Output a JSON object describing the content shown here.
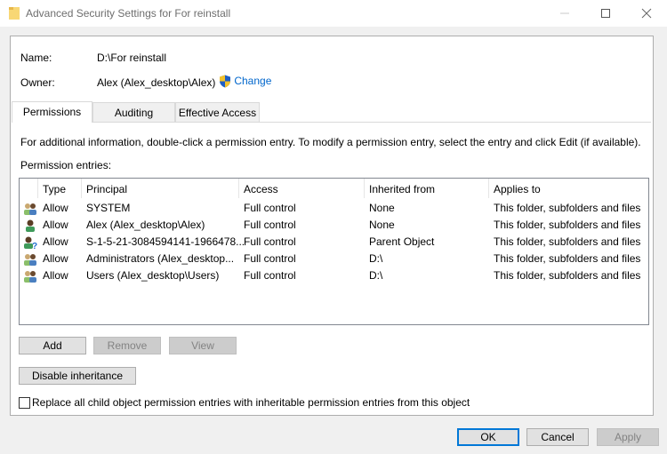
{
  "window": {
    "title": "Advanced Security Settings for For reinstall",
    "icon": "folder-icon",
    "controls": [
      "minimize-icon",
      "maximize-icon",
      "close-icon"
    ]
  },
  "info": {
    "name_label": "Name:",
    "name_value": "D:\\For reinstall",
    "owner_label": "Owner:",
    "owner_value": "Alex (Alex_desktop\\Alex)",
    "change_label": "Change",
    "change_icon": "uac-shield-icon"
  },
  "tabs": [
    {
      "label": "Permissions",
      "active": true
    },
    {
      "label": "Auditing",
      "active": false
    },
    {
      "label": "Effective Access",
      "active": false
    }
  ],
  "instructions": "For additional information, double-click a permission entry. To modify a permission entry, select the entry and click Edit (if available).",
  "entries_label": "Permission entries:",
  "table": {
    "columns": [
      "Type",
      "Principal",
      "Access",
      "Inherited from",
      "Applies to"
    ],
    "rows": [
      {
        "icon": "group-icon",
        "type": "Allow",
        "principal": "SYSTEM",
        "access": "Full control",
        "inherited": "None",
        "applies": "This folder, subfolders and files"
      },
      {
        "icon": "user-icon",
        "type": "Allow",
        "principal": "Alex (Alex_desktop\\Alex)",
        "access": "Full control",
        "inherited": "None",
        "applies": "This folder, subfolders and files"
      },
      {
        "icon": "unknown-user-icon",
        "type": "Allow",
        "principal": "S-1-5-21-3084594141-1966478...",
        "access": "Full control",
        "inherited": "Parent Object",
        "applies": "This folder, subfolders and files"
      },
      {
        "icon": "group-icon",
        "type": "Allow",
        "principal": "Administrators (Alex_desktop...",
        "access": "Full control",
        "inherited": "D:\\",
        "applies": "This folder, subfolders and files"
      },
      {
        "icon": "group-icon",
        "type": "Allow",
        "principal": "Users (Alex_desktop\\Users)",
        "access": "Full control",
        "inherited": "D:\\",
        "applies": "This folder, subfolders and files"
      }
    ]
  },
  "buttons": {
    "add": "Add",
    "remove": "Remove",
    "view": "View",
    "disable_inheritance": "Disable inheritance",
    "ok": "OK",
    "cancel": "Cancel",
    "apply": "Apply"
  },
  "replace_checkbox": {
    "label": "Replace all child object permission entries with inheritable permission entries from this object",
    "checked": false
  }
}
